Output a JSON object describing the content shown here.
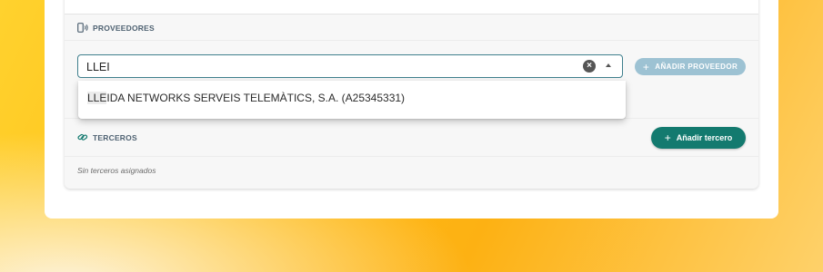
{
  "providers": {
    "title": "PROVEEDORES",
    "input_value": "LLEI",
    "add_button_label": "AÑADIR PROVEEDOR",
    "dropdown": {
      "option_match": "LLE",
      "option_rest": "IDA NETWORKS SERVEIS TELEMÀTICS, S.A. (A25345331)"
    }
  },
  "third_parties": {
    "title": "TERCEROS",
    "add_button_label": "Añadir tercero",
    "empty_text": "Sin terceros asignados"
  },
  "colors": {
    "accent_teal": "#137a6f",
    "input_border": "#3f7f8d",
    "disabled_button": "#9dc2d3"
  },
  "icons": {
    "providers": "phone-wave-icon",
    "third_parties": "link-icon",
    "clear": "clear-icon",
    "dropdown": "caret-up-icon",
    "add": "plus-icon"
  }
}
